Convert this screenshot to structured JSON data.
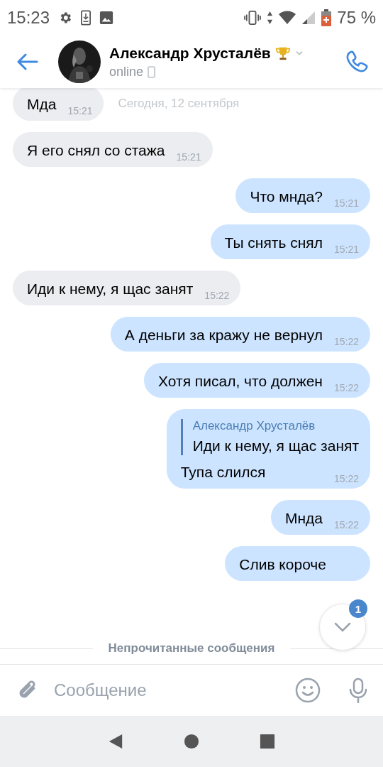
{
  "status_bar": {
    "time": "15:23",
    "battery": "75 %"
  },
  "header": {
    "name": "Александр Хрусталёв",
    "status": "online"
  },
  "date_label": "Сегодня, 12 сентября",
  "messages": [
    {
      "kind": "in",
      "text": "Мда",
      "time": "15:21"
    },
    {
      "kind": "in",
      "text": "Я его снял со стажа",
      "time": "15:21"
    },
    {
      "kind": "out",
      "text": "Что мнда?",
      "time": "15:21"
    },
    {
      "kind": "out",
      "text": "Ты снять снял",
      "time": "15:21"
    },
    {
      "kind": "in",
      "text": "Иди к нему, я щас занят",
      "time": "15:22"
    },
    {
      "kind": "out",
      "text": "А деньги за кражу не вернул",
      "time": "15:22"
    },
    {
      "kind": "out",
      "text": "Хотя писал, что должен",
      "time": "15:22"
    },
    {
      "kind": "out",
      "reply": {
        "author": "Александр Хрусталёв",
        "text": "Иди к нему, я щас занят"
      },
      "text": "Тупа слился",
      "time": "15:22"
    },
    {
      "kind": "out",
      "text": "Мнда",
      "time": "15:22"
    },
    {
      "kind": "out",
      "text": "Слив короче"
    }
  ],
  "unread_divider": "Непрочитанные сообщения",
  "scroll_button": {
    "badge": "1"
  },
  "composer": {
    "placeholder": "Сообщение"
  }
}
